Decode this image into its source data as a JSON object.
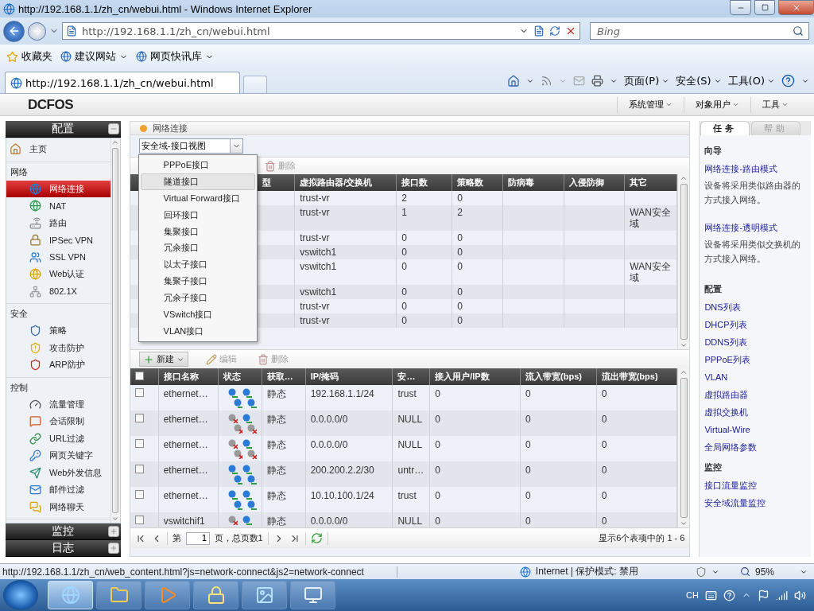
{
  "browser": {
    "title": "http://192.168.1.1/zh_cn/webui.html - Windows Internet Explorer",
    "address": "http://192.168.1.1/zh_cn/webui.html",
    "search_placeholder": "Bing",
    "favorites": [
      {
        "label": "收藏夹",
        "kind": "star"
      },
      {
        "label": "建议网站",
        "kind": "link"
      },
      {
        "label": "网页快讯库",
        "kind": "link"
      }
    ],
    "tabs": [
      {
        "label": "http://192.168.1.1/zh_cn/webui.html",
        "selected": true
      }
    ],
    "commands": [
      "页面(P)",
      "安全(S)",
      "工具(O)"
    ]
  },
  "app": {
    "logo": "DCFOS",
    "menus": [
      "系统管理",
      "对象用户",
      "工具"
    ]
  },
  "sidebar": {
    "panels": [
      {
        "title": "配置",
        "expanded": true,
        "groups": [
          {
            "items": [
              {
                "label": "主页",
                "selected": false
              }
            ]
          },
          {
            "title": "网络",
            "items": [
              {
                "label": "网络连接",
                "selected": true
              },
              {
                "label": "NAT",
                "selected": false
              },
              {
                "label": "路由",
                "selected": false
              },
              {
                "label": "IPSec VPN",
                "selected": false
              },
              {
                "label": "SSL VPN",
                "selected": false
              },
              {
                "label": "Web认证",
                "selected": false
              },
              {
                "label": "802.1X",
                "selected": false
              }
            ]
          },
          {
            "title": "安全",
            "items": [
              {
                "label": "策略",
                "selected": false
              },
              {
                "label": "攻击防护",
                "selected": false
              },
              {
                "label": "ARP防护",
                "selected": false
              }
            ]
          },
          {
            "title": "控制",
            "items": [
              {
                "label": "流量管理",
                "selected": false
              },
              {
                "label": "会话限制",
                "selected": false
              },
              {
                "label": "URL过滤",
                "selected": false
              },
              {
                "label": "网页关键字",
                "selected": false
              },
              {
                "label": "Web外发信息",
                "selected": false
              },
              {
                "label": "邮件过滤",
                "selected": false
              },
              {
                "label": "网络聊天",
                "selected": false
              }
            ]
          }
        ]
      },
      {
        "title": "监控",
        "expanded": false
      },
      {
        "title": "日志",
        "expanded": false
      }
    ]
  },
  "center": {
    "title": "网络连接",
    "view_select": "安全域-接口视图",
    "top_toolbar": [
      {
        "label": "删除",
        "disabled": true
      }
    ],
    "zone_table": {
      "columns": [
        "型",
        "虚拟路由器/交换机",
        "接口数",
        "策略数",
        "防病毒",
        "入侵防御",
        "其它"
      ],
      "rows": [
        {
          "vr": "trust-vr",
          "ports": "2",
          "policies": "0"
        },
        {
          "vr": "trust-vr",
          "ports": "1",
          "policies": "2",
          "other": "WAN安全域"
        },
        {
          "vr": "trust-vr",
          "ports": "0",
          "policies": "0"
        },
        {
          "vr": "vswitch1",
          "ports": "0",
          "policies": "0"
        },
        {
          "vr": "vswitch1",
          "ports": "0",
          "policies": "0",
          "other": "WAN安全域"
        },
        {
          "vr": "vswitch1",
          "ports": "0",
          "policies": "0"
        },
        {
          "vr": "trust-vr",
          "ports": "0",
          "policies": "0"
        },
        {
          "vr": "trust-vr",
          "ports": "0",
          "policies": "0"
        }
      ]
    },
    "new_menu": {
      "items": [
        {
          "label": "PPPoE接口",
          "selected": false
        },
        {
          "label": "隧道接口",
          "selected": true
        },
        {
          "label": "Virtual Forward接口",
          "selected": false
        },
        {
          "label": "回环接口",
          "selected": false
        },
        {
          "label": "集聚接口",
          "selected": false
        },
        {
          "label": "冗余接口",
          "selected": false
        },
        {
          "label": "以太子接口",
          "selected": false
        },
        {
          "label": "集聚子接口",
          "selected": false
        },
        {
          "label": "冗余子接口",
          "selected": false
        },
        {
          "label": "VSwitch接口",
          "selected": false
        },
        {
          "label": "VLAN接口",
          "selected": false
        }
      ]
    },
    "bottom_toolbar": [
      {
        "label": "新建",
        "disabled": false,
        "kind": "menu"
      },
      {
        "label": "编辑",
        "disabled": true,
        "kind": "edit"
      },
      {
        "label": "删除",
        "disabled": true,
        "kind": "delete"
      }
    ],
    "interfaces": {
      "all_checked": false,
      "columns": [
        "接口名称",
        "状态",
        "获取…",
        "IP/掩码",
        "安…",
        "接入用户/IP数",
        "流入带宽(bps)",
        "流出带宽(bps)"
      ],
      "rows": [
        {
          "checked": false,
          "name": "ethernet…",
          "ports_up": [
            true,
            true,
            true,
            true
          ],
          "mode": "静态",
          "ip": "192.168.1.1/24",
          "zone": "trust",
          "users": "0",
          "in": "0",
          "out": "0"
        },
        {
          "checked": false,
          "name": "ethernet…",
          "ports_up": [
            false,
            true,
            false,
            false
          ],
          "mode": "静态",
          "ip": "0.0.0.0/0",
          "zone": "NULL",
          "users": "0",
          "in": "0",
          "out": "0"
        },
        {
          "checked": false,
          "name": "ethernet…",
          "ports_up": [
            false,
            true,
            false,
            false
          ],
          "mode": "静态",
          "ip": "0.0.0.0/0",
          "zone": "NULL",
          "users": "0",
          "in": "0",
          "out": "0"
        },
        {
          "checked": false,
          "name": "ethernet…",
          "ports_up": [
            true,
            true,
            true,
            true
          ],
          "mode": "静态",
          "ip": "200.200.2.2/30",
          "zone": "untr…",
          "users": "0",
          "in": "0",
          "out": "0"
        },
        {
          "checked": false,
          "name": "ethernet…",
          "ports_up": [
            true,
            true,
            true,
            true
          ],
          "mode": "静态",
          "ip": "10.10.100.1/24",
          "zone": "trust",
          "users": "0",
          "in": "0",
          "out": "0"
        },
        {
          "checked": false,
          "name": "vswitchif1",
          "ports_up": [
            false,
            true
          ],
          "mode": "静态",
          "ip": "0.0.0.0/0",
          "zone": "NULL",
          "users": "0",
          "in": "0",
          "out": "0"
        }
      ]
    },
    "pager": {
      "page_label": "第",
      "page": "1",
      "total_label": "页，总页数1",
      "summary": "显示6个表项中的 1 - 6"
    }
  },
  "right": {
    "tabs": [
      {
        "label": "任务",
        "selected": true
      },
      {
        "label": "帮助",
        "selected": false
      }
    ],
    "sections": [
      {
        "title": "向导",
        "entries": [
          {
            "kind": "link",
            "text": "网络连接-路由模式"
          },
          {
            "kind": "text",
            "text": "设备将采用类似路由器的方式接入网络。"
          },
          {
            "kind": "link",
            "text": "网络连接-透明模式"
          },
          {
            "kind": "text",
            "text": "设备将采用类似交换机的方式接入网络。"
          }
        ]
      },
      {
        "title": "配置",
        "entries": [
          {
            "kind": "link",
            "text": "DNS列表"
          },
          {
            "kind": "link",
            "text": "DHCP列表"
          },
          {
            "kind": "link",
            "text": "DDNS列表"
          },
          {
            "kind": "link",
            "text": "PPPoE列表"
          },
          {
            "kind": "link",
            "text": "VLAN"
          },
          {
            "kind": "link",
            "text": "虚拟路由器"
          },
          {
            "kind": "link",
            "text": "虚拟交换机"
          },
          {
            "kind": "link",
            "text": "Virtual-Wire"
          },
          {
            "kind": "link",
            "text": "全局网络参数"
          }
        ]
      },
      {
        "title": "监控",
        "entries": [
          {
            "kind": "link",
            "text": "接口流量监控"
          },
          {
            "kind": "link",
            "text": "安全域流量监控"
          }
        ]
      }
    ]
  },
  "status_bar": {
    "url": "http://192.168.1.1/zh_cn/web_content.html?js=network-connect&js2=network-connect",
    "zone": "Internet | 保护模式: 禁用",
    "zoom": "95%"
  },
  "taskbar": {
    "apps": [
      {
        "selected": true
      },
      {
        "selected": false
      },
      {
        "selected": false
      },
      {
        "selected": false
      },
      {
        "selected": false
      },
      {
        "selected": false
      }
    ],
    "language": "CH"
  }
}
